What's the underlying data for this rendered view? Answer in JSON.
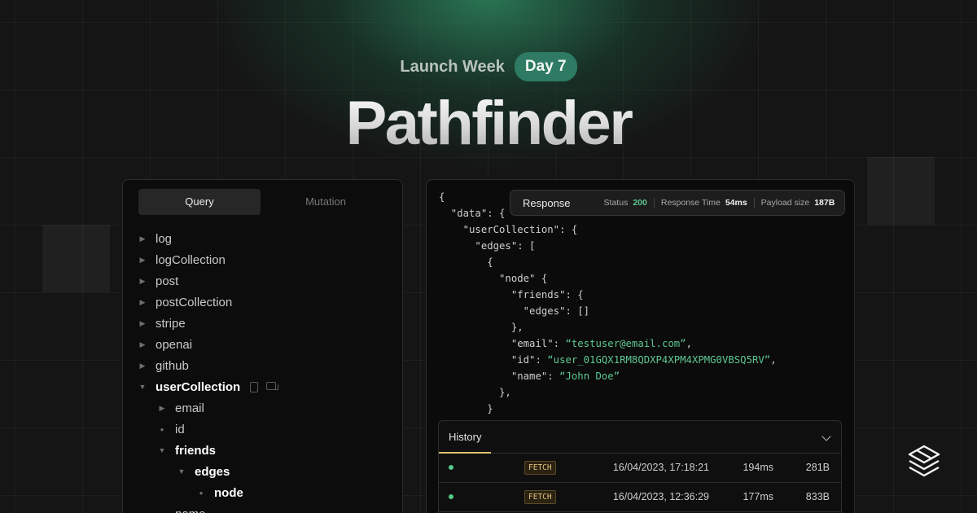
{
  "header": {
    "event": "Launch Week",
    "day_badge": "Day 7",
    "title": "Pathfinder"
  },
  "left_panel": {
    "tabs": [
      {
        "label": "Query",
        "active": true
      },
      {
        "label": "Mutation",
        "active": false
      }
    ],
    "tree": [
      {
        "label": "log",
        "depth": 0,
        "state": "collapsed"
      },
      {
        "label": "logCollection",
        "depth": 0,
        "state": "collapsed"
      },
      {
        "label": "post",
        "depth": 0,
        "state": "collapsed"
      },
      {
        "label": "postCollection",
        "depth": 0,
        "state": "collapsed"
      },
      {
        "label": "stripe",
        "depth": 0,
        "state": "collapsed"
      },
      {
        "label": "openai",
        "depth": 0,
        "state": "collapsed"
      },
      {
        "label": "github",
        "depth": 0,
        "state": "collapsed"
      },
      {
        "label": "userCollection",
        "depth": 0,
        "state": "expanded"
      },
      {
        "label": "email",
        "depth": 1,
        "state": "collapsed"
      },
      {
        "label": "id",
        "depth": 1,
        "state": "leaf"
      },
      {
        "label": "friends",
        "depth": 1,
        "state": "expanded"
      },
      {
        "label": "edges",
        "depth": 2,
        "state": "expanded"
      },
      {
        "label": "node",
        "depth": 3,
        "state": "leaf"
      },
      {
        "label": "name",
        "depth": 1,
        "state": "leaf"
      }
    ]
  },
  "response": {
    "label": "Response",
    "status_label": "Status",
    "status_value": "200",
    "time_label": "Response Time",
    "time_value": "54ms",
    "size_label": "Payload size",
    "size_value": "187B",
    "strings": {
      "email": "“testuser@email.com”",
      "id": "“user_01GQX1RM8QDXP4XPM4XPMG0VBSQ5RV”",
      "name": "“John Doe”"
    }
  },
  "history": {
    "title": "History",
    "rows": [
      {
        "method": "FETCH",
        "date": "16/04/2023, 17:18:21",
        "duration": "194ms",
        "size": "281B"
      },
      {
        "method": "FETCH",
        "date": "16/04/2023, 12:36:29",
        "duration": "177ms",
        "size": "833B"
      }
    ]
  },
  "colors": {
    "accent_green": "#5fc794",
    "badge_green": "#2e7a63",
    "history_tab_underline": "#e1bf6c"
  },
  "icons": [
    "caret-right-icon",
    "caret-down-icon",
    "document-icon",
    "copy-icon",
    "chevron-down-icon",
    "stacked-layers-logo-icon"
  ]
}
